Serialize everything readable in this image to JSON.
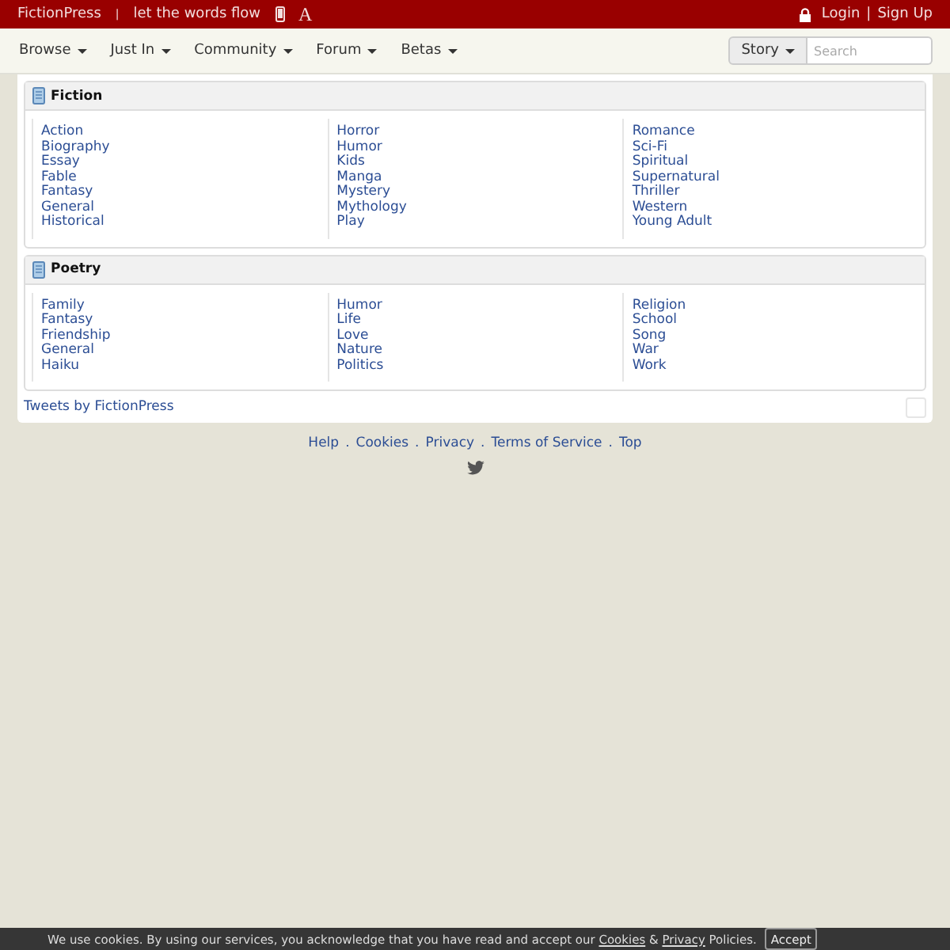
{
  "top_bar": {
    "site_name": "FictionPress",
    "separator": "|",
    "tagline": "let the words flow",
    "font_icon": "A",
    "login": "Login",
    "divider": "|",
    "signup": "Sign Up"
  },
  "nav": {
    "menus": [
      {
        "label": "Browse"
      },
      {
        "label": "Just In"
      },
      {
        "label": "Community"
      },
      {
        "label": "Forum"
      },
      {
        "label": "Betas"
      }
    ],
    "search_type": "Story",
    "search": {
      "placeholder": "Search"
    }
  },
  "categories": [
    {
      "title": "Fiction",
      "columns": [
        [
          "Action",
          "Biography",
          "Essay",
          "Fable",
          "Fantasy",
          "General",
          "Historical"
        ],
        [
          "Horror",
          "Humor",
          "Kids",
          "Manga",
          "Mystery",
          "Mythology",
          "Play"
        ],
        [
          "Romance",
          "Sci-Fi",
          "Spiritual",
          "Supernatural",
          "Thriller",
          "Western",
          "Young Adult"
        ]
      ]
    },
    {
      "title": "Poetry",
      "columns": [
        [
          "Family",
          "Fantasy",
          "Friendship",
          "General",
          "Haiku"
        ],
        [
          "Humor",
          "Life",
          "Love",
          "Nature",
          "Politics"
        ],
        [
          "Religion",
          "School",
          "Song",
          "War",
          "Work"
        ]
      ]
    }
  ],
  "tweets_link": "Tweets by FictionPress",
  "footer": {
    "links": [
      "Help",
      "Cookies",
      "Privacy",
      "Terms of Service",
      "Top"
    ],
    "separators": [
      ".",
      ".",
      ".",
      "."
    ]
  },
  "cookie_bar": {
    "parts": [
      {
        "kind": "text",
        "text": "We use cookies. By using our services, you acknowledge that you have read and accept our "
      },
      {
        "kind": "link",
        "text": "Cookies"
      },
      {
        "kind": "text",
        "text": " & "
      },
      {
        "kind": "link",
        "text": "Privacy"
      },
      {
        "kind": "text",
        "text": " Policies."
      }
    ],
    "button": "Accept"
  }
}
